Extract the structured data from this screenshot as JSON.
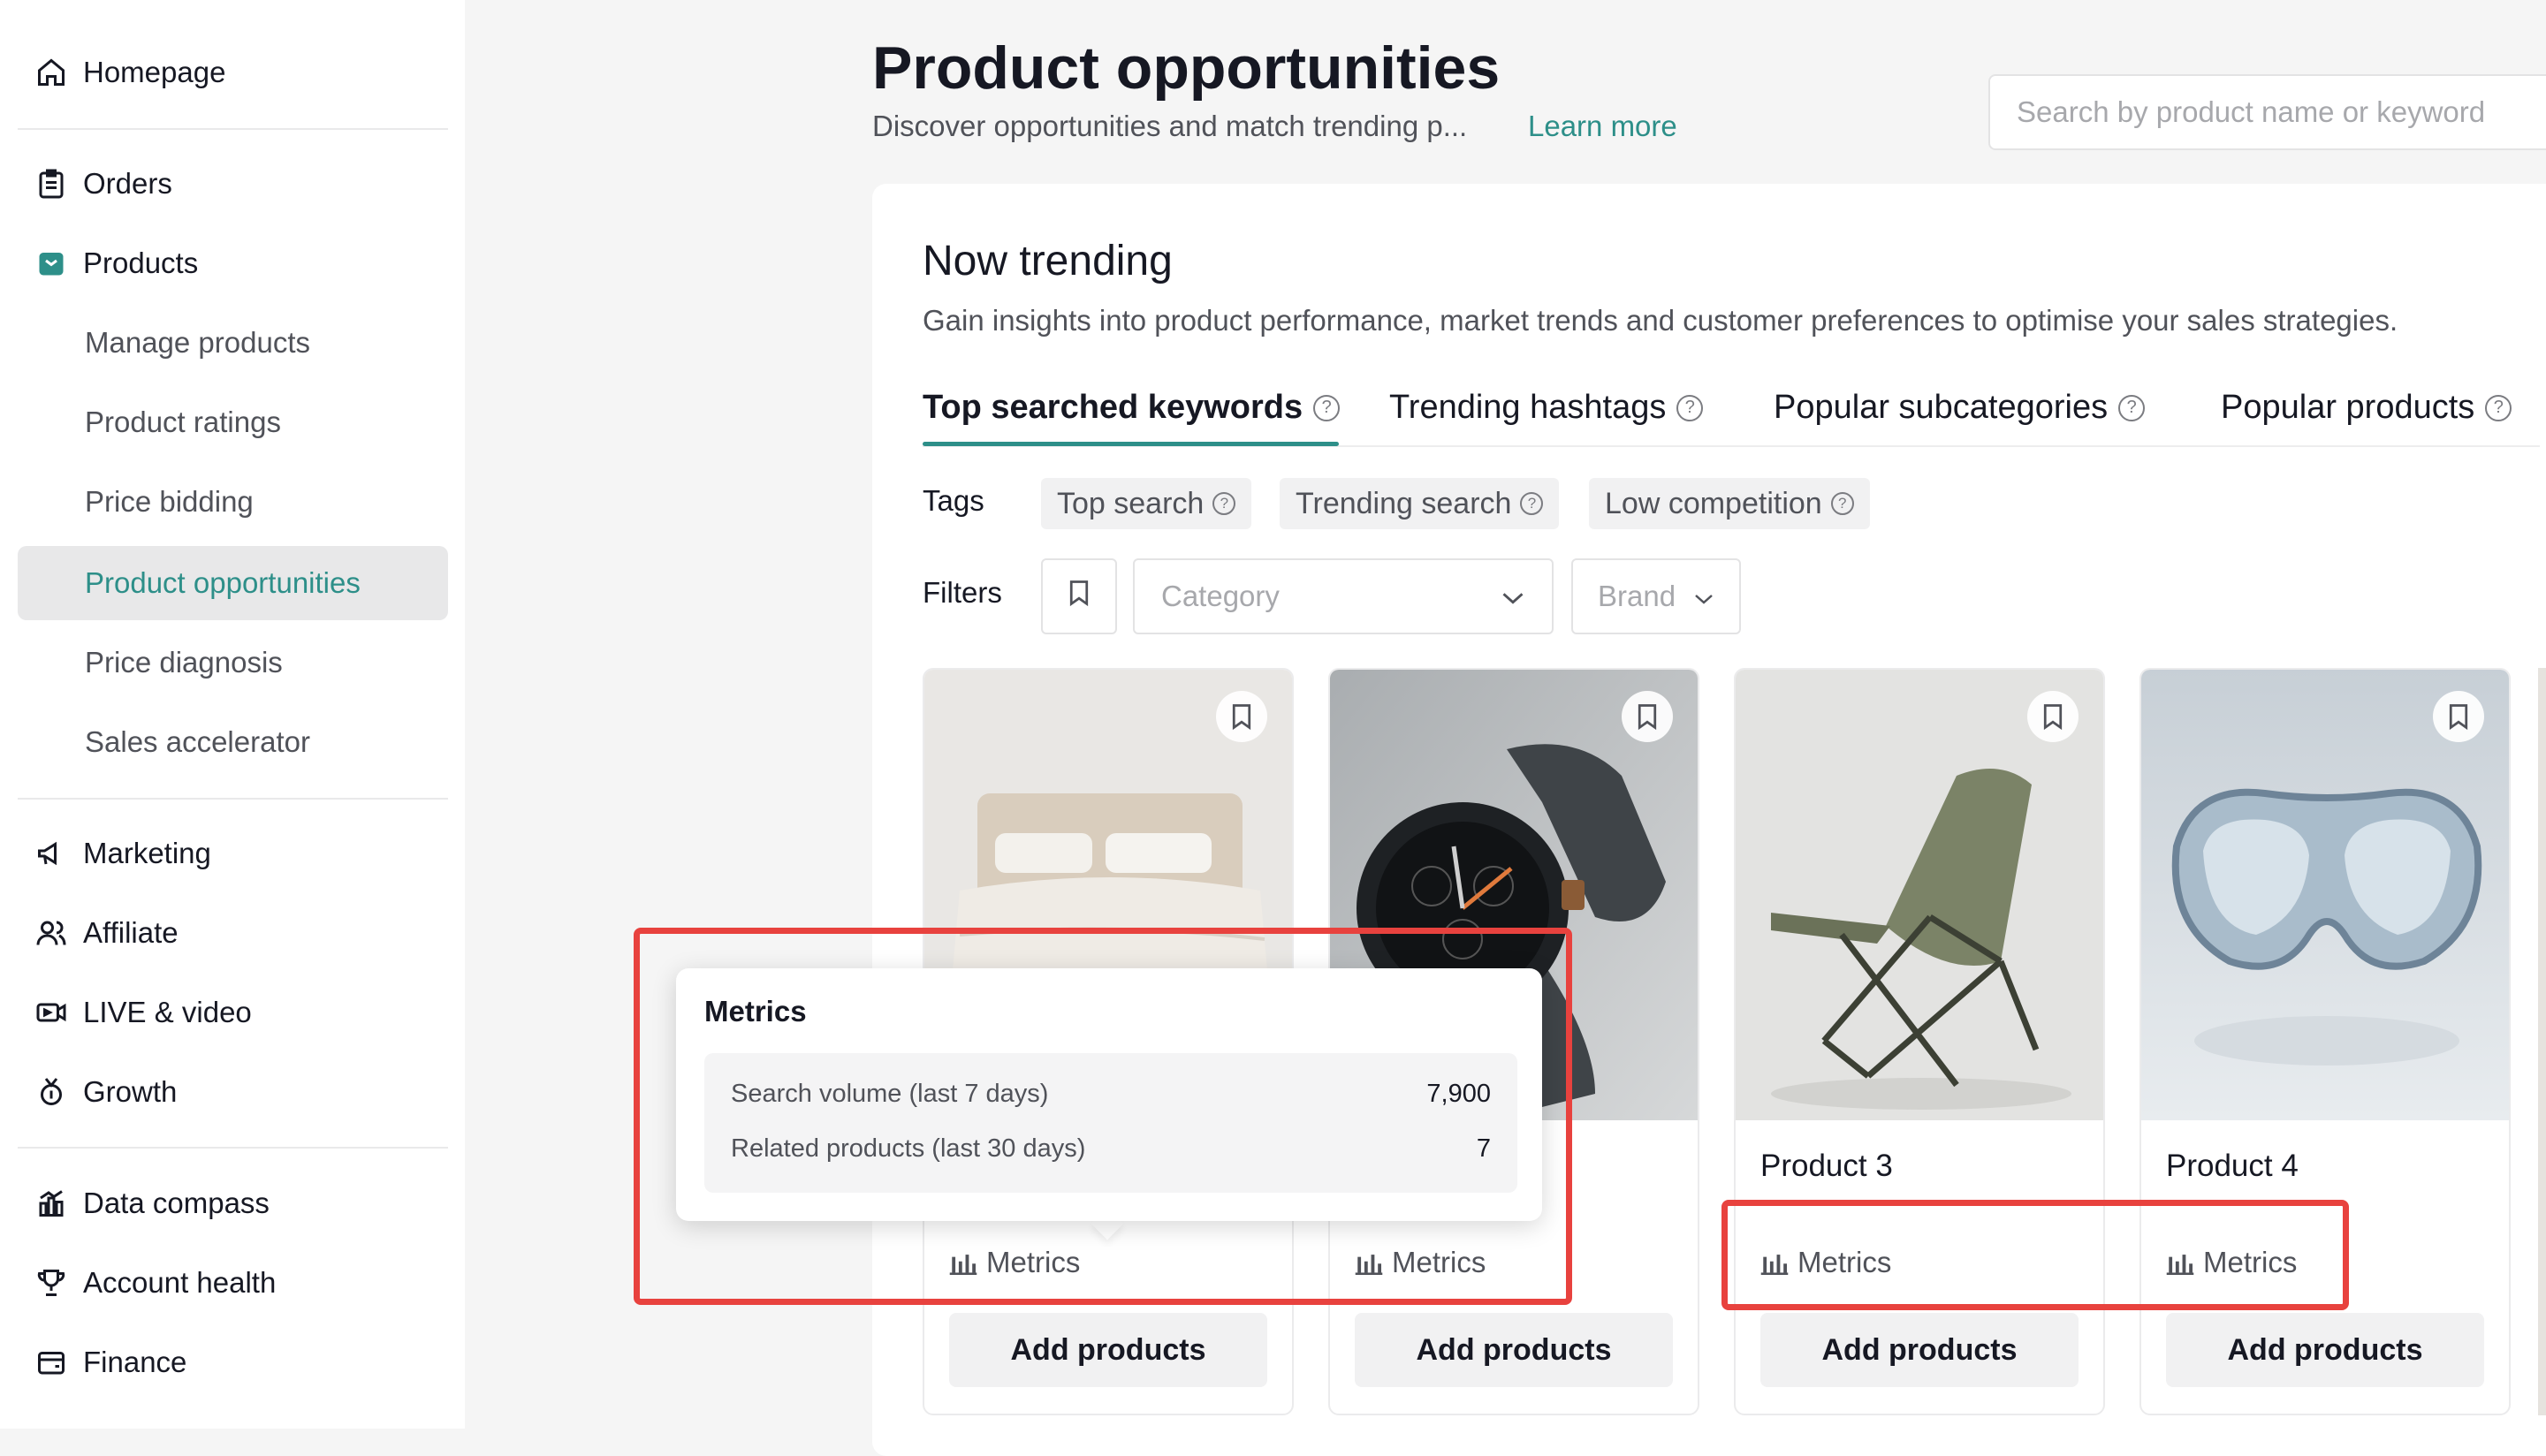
{
  "sidebar": {
    "items": [
      {
        "label": "Homepage",
        "icon": "home-icon"
      },
      {
        "label": "Orders",
        "icon": "clipboard-icon"
      },
      {
        "label": "Products",
        "icon": "bag-icon"
      },
      {
        "label": "Manage products"
      },
      {
        "label": "Product ratings"
      },
      {
        "label": "Price bidding"
      },
      {
        "label": "Product opportunities",
        "active": true
      },
      {
        "label": "Price diagnosis"
      },
      {
        "label": "Sales accelerator"
      },
      {
        "label": "Marketing",
        "icon": "megaphone-icon"
      },
      {
        "label": "Affiliate",
        "icon": "people-icon"
      },
      {
        "label": "LIVE & video",
        "icon": "video-icon"
      },
      {
        "label": "Growth",
        "icon": "medal-icon"
      },
      {
        "label": "Data compass",
        "icon": "bar-chart-icon"
      },
      {
        "label": "Account health",
        "icon": "trophy-icon"
      },
      {
        "label": "Finance",
        "icon": "wallet-icon"
      }
    ]
  },
  "header": {
    "title": "Product opportunities",
    "subtitle": "Discover opportunities and match trending p...",
    "learn_more": "Learn more",
    "search_placeholder": "Search by product name or keyword"
  },
  "section": {
    "title": "Now trending",
    "description": "Gain insights into product performance, market trends and customer preferences to optimise your sales strategies."
  },
  "tabs": [
    {
      "label": "Top searched keywords",
      "active": true
    },
    {
      "label": "Trending hashtags"
    },
    {
      "label": "Popular subcategories"
    },
    {
      "label": "Popular products"
    }
  ],
  "tags": {
    "label": "Tags",
    "items": [
      "Top search",
      "Trending search",
      "Low competition"
    ]
  },
  "filters": {
    "label": "Filters",
    "category_placeholder": "Category",
    "brand_placeholder": "Brand"
  },
  "cards": [
    {
      "name": "",
      "image": "bed",
      "metrics_label": "Metrics",
      "button": "Add products"
    },
    {
      "name": "",
      "image": "watch",
      "metrics_label": "Metrics",
      "button": "Add products"
    },
    {
      "name": "Product 3",
      "image": "folding-chair",
      "metrics_label": "Metrics",
      "button": "Add products"
    },
    {
      "name": "Product 4",
      "image": "diving-mask",
      "metrics_label": "Metrics",
      "button": "Add products"
    }
  ],
  "tooltip": {
    "title": "Metrics",
    "rows": [
      {
        "label": "Search volume (last 7 days)",
        "value": "7,900"
      },
      {
        "label": "Related products (last 30 days)",
        "value": "7"
      }
    ]
  },
  "colors": {
    "accent": "#2d8f89",
    "annotation": "#e8423e"
  }
}
